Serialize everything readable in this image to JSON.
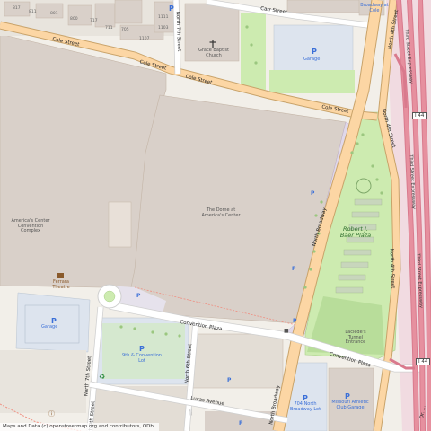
{
  "map": {
    "attribution": "Maps and Data (c) openstreetmap.org and contributors, ODbL",
    "streets": {
      "carr": "Carr Street",
      "cole_1": "Cole Street",
      "cole_2": "Cole Street",
      "cole_3": "Cole Street",
      "cole_4": "Cole Street",
      "n7_top": "North 7th Street",
      "n7_bottom": "North 7th Street",
      "n6": "North 6th Street",
      "n4_top": "North 4th Street",
      "n4_mid": "North 4th Street",
      "n4_bottom": "North 4th Street",
      "broadway_1": "North Broadway",
      "broadway_2": "North Broadway",
      "convention_1": "Convention Plaza",
      "convention_2": "Convention Plaza",
      "lucas": "Lucas Avenue",
      "n9_bottom": "North 9th Street",
      "third_1": "Third Street Expressway",
      "third_2": "Third Street Expressway",
      "third_3": "Third Street Expressway",
      "ormond": "Dr. ..."
    },
    "highway_shield": "I 44",
    "places": {
      "church": "Grace Baptist Church",
      "dome": "The Dome at America's Center",
      "complex": "America's Center Convention Complex",
      "ferrara": "Ferrara Theatre",
      "baer": "Robert J. Baer Plaza",
      "laclede": "Laclede's Tunnel Entrance",
      "broadway_cole": "Broadway at Cole",
      "convention_lot": "9th & Convention Lot",
      "broadway_lot": "704 North Broadway Lot",
      "missouri": "Missouri Athletic Club Garage",
      "parking_small": "Garage"
    },
    "house_numbers": [
      "817",
      "811",
      "801",
      "800",
      "717",
      "711",
      "705",
      "1107",
      "1103",
      "1111"
    ]
  }
}
